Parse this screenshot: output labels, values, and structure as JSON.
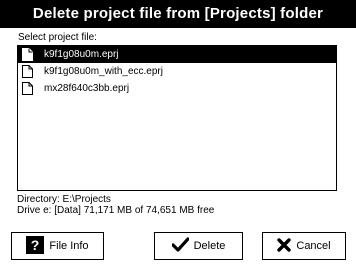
{
  "window": {
    "title": "Delete project file from [Projects] folder"
  },
  "file_list": {
    "label": "Select project file:",
    "items": [
      {
        "name": "k9f1g08u0m.eprj",
        "selected": true
      },
      {
        "name": "k9f1g08u0m_with_ecc.eprj",
        "selected": false
      },
      {
        "name": "mx28f640c3bb.eprj",
        "selected": false
      }
    ]
  },
  "status": {
    "directory": "Directory: E:\\Projects",
    "drive": "Drive e: [Data]  71,171 MB of 74,651 MB free"
  },
  "buttons": {
    "file_info": {
      "label": "File Info",
      "icon": "question-icon"
    },
    "delete": {
      "label": "Delete",
      "icon": "checkmark-icon"
    },
    "cancel": {
      "label": "Cancel",
      "icon": "x-icon"
    }
  }
}
